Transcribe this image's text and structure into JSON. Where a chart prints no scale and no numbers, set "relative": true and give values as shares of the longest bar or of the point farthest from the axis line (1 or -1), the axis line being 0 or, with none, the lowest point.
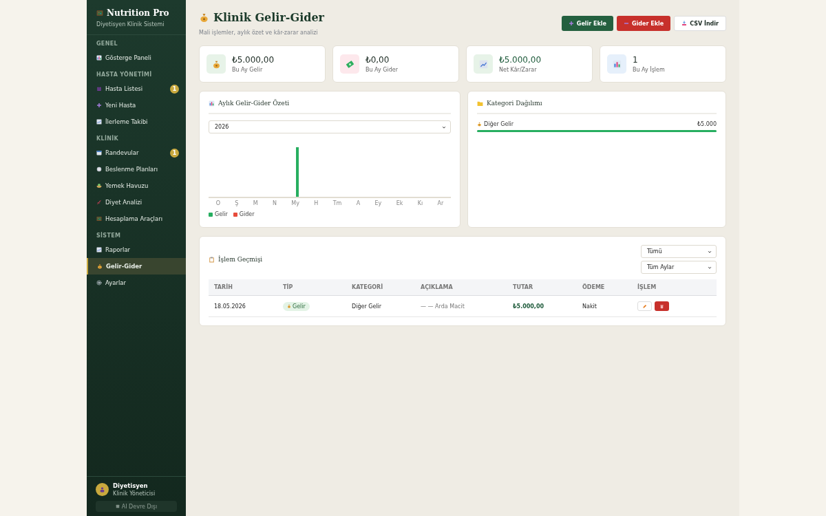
{
  "sidebar": {
    "brand": "Nutrition Pro",
    "subtitle": "Diyetisyen Klinik Sistemi",
    "sections": [
      {
        "title": "GENEL",
        "items": [
          {
            "label": "Gösterge Paneli",
            "selected": false
          }
        ]
      },
      {
        "title": "HASTA YÖNETİMİ",
        "items": [
          {
            "label": "Hasta Listesi",
            "badge": "1",
            "selected": false
          },
          {
            "label": "Yeni Hasta",
            "selected": false
          },
          {
            "label": "İlerleme Takibi",
            "selected": false
          }
        ]
      },
      {
        "title": "KLİNİK",
        "items": [
          {
            "label": "Randevular",
            "badge": "1",
            "selected": false
          },
          {
            "label": "Beslenme Planları",
            "selected": false
          },
          {
            "label": "Yemek Havuzu",
            "selected": false
          },
          {
            "label": "Diyet Analizi",
            "selected": false
          },
          {
            "label": "Hesaplama Araçları",
            "selected": false
          }
        ]
      },
      {
        "title": "SİSTEM",
        "items": [
          {
            "label": "Raporlar",
            "selected": false
          },
          {
            "label": "Gelir-Gider",
            "selected": true
          },
          {
            "label": "Ayarlar",
            "selected": false
          }
        ]
      }
    ],
    "user": {
      "name": "Diyetisyen",
      "role": "Klinik Yöneticisi"
    },
    "ai_button": "AI Devre Dışı"
  },
  "header": {
    "title": "Klinik Gelir-Gider",
    "subtitle": "Mali işlemler, aylık özet ve kâr-zarar analizi",
    "buttons": [
      {
        "label": "Gelir Ekle",
        "kind": "income"
      },
      {
        "label": "Gider Ekle",
        "kind": "expense"
      },
      {
        "label": "CSV İndir",
        "kind": "export"
      }
    ]
  },
  "stats": [
    {
      "value": "₺5.000,00",
      "label": "Bu Ay Gelir"
    },
    {
      "value": "₺0,00",
      "label": "Bu Ay Gider"
    },
    {
      "value": "₺5.000,00",
      "label": "Net Kâr/Zarar"
    },
    {
      "value": "1",
      "label": "Bu Ay İşlem"
    }
  ],
  "monthly": {
    "title": "Aylık Gelir-Gider Özeti",
    "year": "2026",
    "chart_data": {
      "type": "bar",
      "relative": true,
      "categories": [
        "O",
        "Ş",
        "M",
        "N",
        "My",
        "H",
        "Tm",
        "A",
        "Ey",
        "Ek",
        "Kı",
        "Ar"
      ],
      "series": [
        {
          "name": "Gelir",
          "color": "#27ae60",
          "values": [
            0,
            0,
            0,
            0,
            1,
            0,
            0,
            0,
            0,
            0,
            0,
            0
          ]
        },
        {
          "name": "Gider",
          "color": "#e74c3c",
          "values": [
            0,
            0,
            0,
            0,
            0,
            0,
            0,
            0,
            0,
            0,
            0,
            0
          ]
        }
      ]
    }
  },
  "categories": {
    "title": "Kategori Dağılımı",
    "items": [
      {
        "name": "Diğer Gelir",
        "amount": "₺5.000",
        "level": 1
      }
    ]
  },
  "history": {
    "title": "İşlem Geçmişi",
    "type_filter": "Tümü",
    "month_filter": "Tüm Aylar",
    "columns": [
      "TARİH",
      "TİP",
      "KATEGORİ",
      "AÇIKLAMA",
      "TUTAR",
      "ÖDEME",
      "İŞLEM"
    ],
    "rows": [
      {
        "date": "18.05.2026",
        "type": "Gelir",
        "category": "Diğer Gelir",
        "description": "— — Arda Macit",
        "amount": "₺5.000,00",
        "payment": "Nakit"
      }
    ]
  }
}
